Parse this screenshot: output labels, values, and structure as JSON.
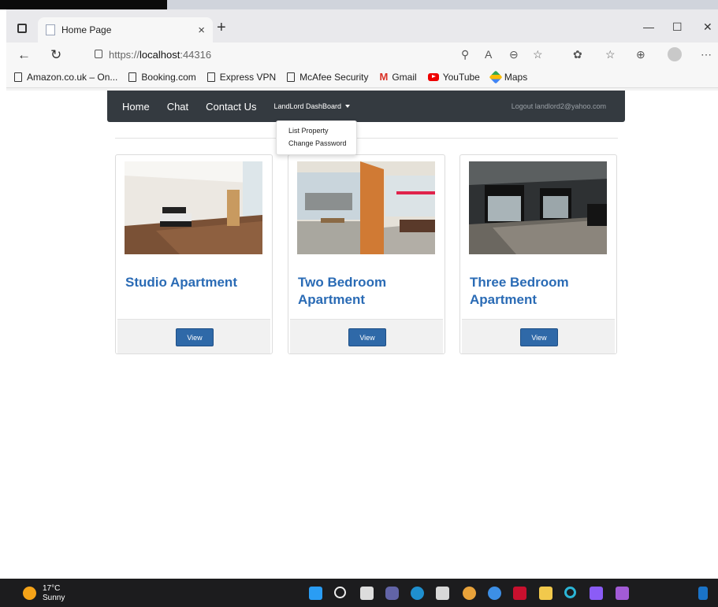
{
  "browser": {
    "tab_title": "Home Page",
    "tab_close": "×",
    "new_tab": "+",
    "url_prefix": "https://",
    "url_host": "localhost",
    "url_port": ":44316",
    "window_controls": [
      "—",
      "☐",
      "✕"
    ],
    "bookmarks": [
      "Amazon.co.uk – On...",
      "Booking.com",
      "Express VPN",
      "McAfee Security",
      "Gmail",
      "YouTube",
      "Maps"
    ]
  },
  "navbar": {
    "links": [
      "Home",
      "Chat",
      "Contact Us"
    ],
    "dashboard": "LandLord DashBoard",
    "logout": "Logout landlord2@yahoo.com"
  },
  "dropdown": {
    "items": [
      "List Property",
      "Change Password"
    ]
  },
  "listings": [
    {
      "title": "Studio Apartment",
      "button": "View"
    },
    {
      "title": "Two Bedroom Apartment",
      "button": "View"
    },
    {
      "title": "Three Bedroom Apartment",
      "button": "View"
    }
  ],
  "taskbar": {
    "temperature": "17°C",
    "condition": "Sunny"
  }
}
